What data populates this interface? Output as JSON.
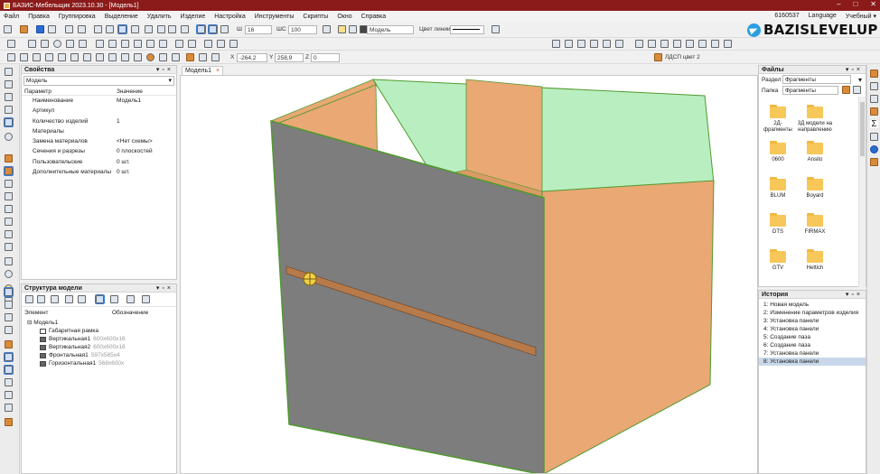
{
  "window": {
    "title": "БАЗИС-Мебельщик 2023.10.30 - [Модель1]",
    "controls": [
      "–",
      "□",
      "✕"
    ]
  },
  "menu": {
    "items": [
      "Файл",
      "Правка",
      "Группировка",
      "Выделение",
      "Удалить",
      "Изделие",
      "Настройка",
      "Инструменты",
      "Скрипты",
      "Окно",
      "Справка"
    ],
    "right": [
      "6160537",
      "Language",
      "Учебный ▾"
    ]
  },
  "toolbar": {
    "line_width_label": "Ш",
    "line_width_value": "16",
    "shadow_label": "ШС",
    "shadow_value": "100",
    "layer_value": "Модель",
    "line_color_label": "Цвет линии",
    "coord_x_label": "X",
    "coord_x_value": "-264,2",
    "coord_y_label": "Y",
    "coord_y_value": "258,9",
    "coord_z_label": "Z",
    "coord_z_value": "0",
    "material_value": "ЛДСП цвет 2"
  },
  "watermark": "BAZISLEVELUP",
  "properties": {
    "title": "Свойства",
    "object_select": "Модель",
    "col_param": "Параметр",
    "col_value": "Значение",
    "rows": [
      {
        "k": "Наименование",
        "v": "Модель1"
      },
      {
        "k": "Артикул",
        "v": ""
      },
      {
        "k": "Количество изделий",
        "v": "1"
      },
      {
        "k": "Материалы",
        "v": ""
      },
      {
        "k": "Замена материалов",
        "v": "<Нет схемы>"
      },
      {
        "k": "Сечения и разрезы",
        "v": "0 плоскостей"
      },
      {
        "k": "Пользовательские",
        "v": "0 шт."
      },
      {
        "k": "Дополнительные материалы",
        "v": "0 шт."
      }
    ]
  },
  "structure": {
    "title": "Структура модели",
    "col_element": "Элемент",
    "col_desc": "Обозначение",
    "root": "Модель1",
    "items": [
      {
        "name": "Габаритная рамка",
        "dim": ""
      },
      {
        "name": "Вертикальная1",
        "dim": "600x600x16"
      },
      {
        "name": "Вертикальная2",
        "dim": "600x600x16"
      },
      {
        "name": "Фронтальная1",
        "dim": "597x585x4"
      },
      {
        "name": "Горизонтальная1",
        "dim": "568x600x"
      }
    ]
  },
  "document_tab": {
    "label": "Модель1",
    "close": "×"
  },
  "files": {
    "title": "Файлы",
    "section_label": "Раздел",
    "section_value": "Фрагменты",
    "folder_label": "Папка",
    "folder_value": "Фрагменты",
    "items": [
      "2Д-фрагменты",
      "3Д модели на направлению",
      "0600",
      "Ansito",
      "BLUM",
      "Boyard",
      "DTS",
      "FIRMAX",
      "GTV",
      "Hettich"
    ]
  },
  "history": {
    "title": "История",
    "items": [
      "1:  Новая модель",
      "2:  Изменение параметров изделия",
      "3:  Установка панели",
      "4:  Установка панели",
      "5:  Создание паза",
      "6:  Создание паза",
      "7:  Установка панели",
      "8:  Установка панели"
    ],
    "active_index": 7
  },
  "colors": {
    "titlebar": "#8b1a1a",
    "panel_orange": "#e9a874",
    "panel_gray": "#7d7d7d",
    "panel_green": "#b9efc0",
    "groove": "#b77a4a",
    "edge_green": "#4f9a2e"
  }
}
